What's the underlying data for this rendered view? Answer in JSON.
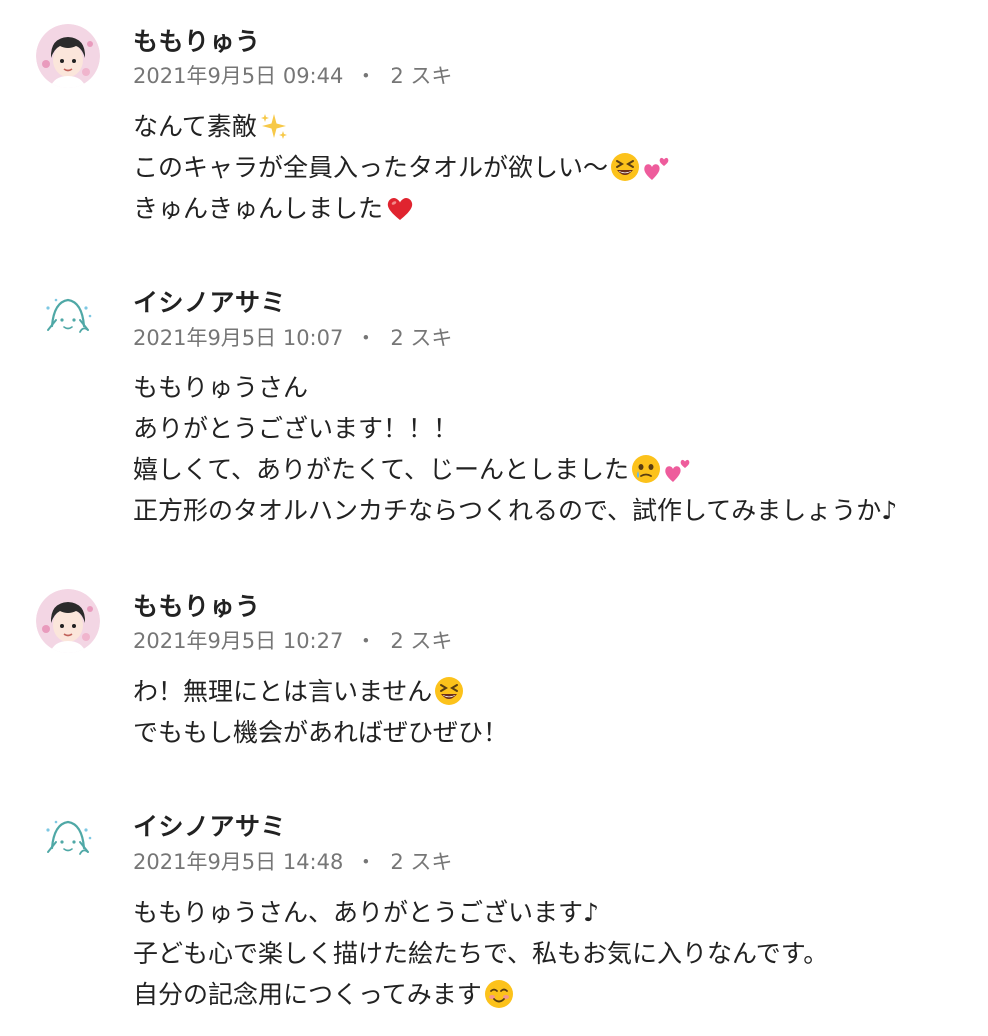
{
  "comments": [
    {
      "author": "ももりゅう",
      "date": "2021年9月5日 09:44",
      "separator": "・",
      "likes": "2 スキ",
      "lines": [
        {
          "text": "なんて素敵",
          "emoji": [
            "sparkles"
          ]
        },
        {
          "text": "このキャラが全員入ったタオルが欲しい〜",
          "emoji": [
            "grinning-squinting-face",
            "two-hearts"
          ]
        },
        {
          "text": "きゅんきゅんしました",
          "emoji": [
            "red-heart"
          ]
        }
      ],
      "avatar": "momoryu-avatar"
    },
    {
      "author": "イシノアサミ",
      "date": "2021年9月5日 10:07",
      "separator": "・",
      "likes": "2 スキ",
      "lines": [
        {
          "text": "ももりゅうさん",
          "emoji": []
        },
        {
          "text": "ありがとうございます！！！",
          "emoji": []
        },
        {
          "text": "嬉しくて、ありがたくて、じーんとしました",
          "emoji": [
            "face-holding-back-tears",
            "two-hearts"
          ]
        },
        {
          "text": "正方形のタオルハンカチならつくれるので、試作してみましょうか♪",
          "emoji": []
        }
      ],
      "avatar": "ishino-asami-avatar"
    },
    {
      "author": "ももりゅう",
      "date": "2021年9月5日 10:27",
      "separator": "・",
      "likes": "2 スキ",
      "lines": [
        {
          "text": "わ！無理にとは言いません",
          "emoji": [
            "grinning-squinting-face"
          ]
        },
        {
          "text": "でももし機会があればぜひぜひ！",
          "emoji": []
        }
      ],
      "avatar": "momoryu-avatar"
    },
    {
      "author": "イシノアサミ",
      "date": "2021年9月5日 14:48",
      "separator": "・",
      "likes": "2 スキ",
      "lines": [
        {
          "text": "ももりゅうさん、ありがとうございます♪",
          "emoji": []
        },
        {
          "text": "子ども心で楽しく描けた絵たちで、私もお気に入りなんです。",
          "emoji": []
        },
        {
          "text": "自分の記念用につくってみます",
          "emoji": [
            "smiling-face"
          ]
        }
      ],
      "avatar": "ishino-asami-avatar"
    }
  ],
  "colors": {
    "text": "#222222",
    "meta": "#767676",
    "background": "#ffffff"
  }
}
